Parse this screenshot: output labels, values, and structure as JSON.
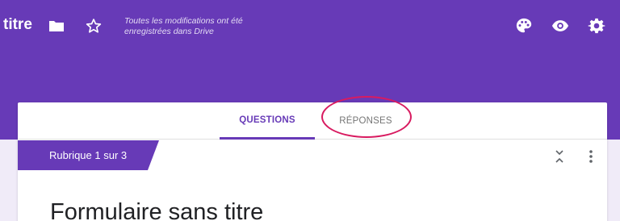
{
  "header": {
    "app_title": "titre",
    "save_status": "Toutes les modifications ont été enregistrées dans Drive",
    "icons": [
      "folder-icon",
      "star-icon",
      "palette-icon",
      "eye-icon",
      "gear-icon"
    ]
  },
  "tabs": [
    {
      "label": "QUESTIONS",
      "active": true
    },
    {
      "label": "RÉPONSES",
      "active": false
    }
  ],
  "section": {
    "label": "Rubrique 1 sur 3"
  },
  "form": {
    "title": "Formulaire sans titre"
  },
  "colors": {
    "accent": "#673ab7",
    "background": "#f0ebf8",
    "highlight": "#d81b60"
  }
}
